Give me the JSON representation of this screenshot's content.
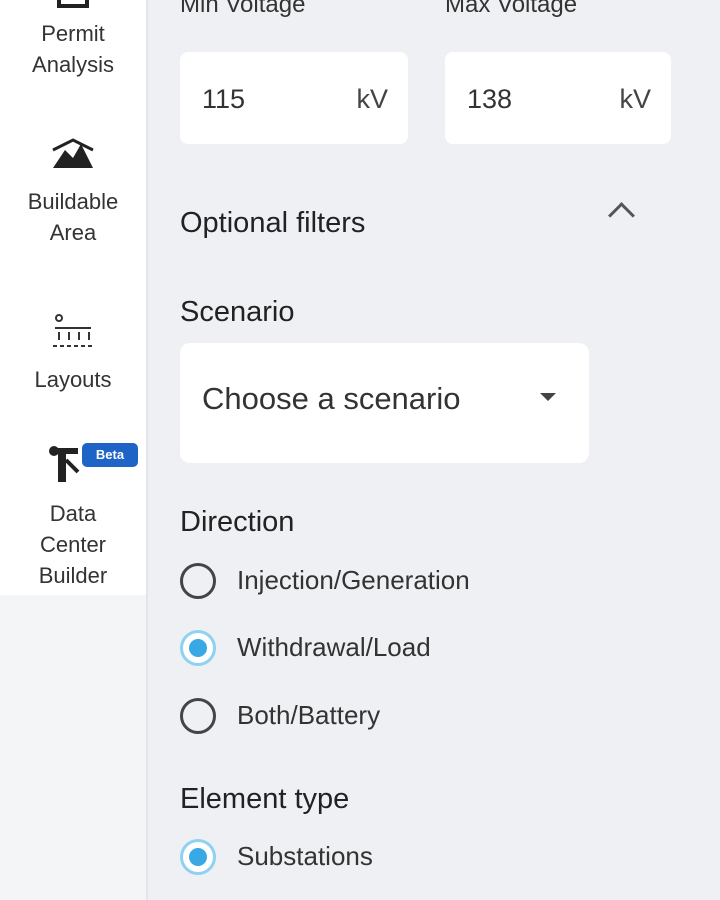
{
  "sidebar": {
    "items": [
      {
        "label": "Permit\nAnalysis",
        "icon": "document-icon"
      },
      {
        "label": "Buildable\nArea",
        "icon": "terrain-icon"
      },
      {
        "label": "Layouts",
        "icon": "layout-grid-icon"
      },
      {
        "label": "Data\nCenter\nBuilder",
        "icon": "crane-icon",
        "badge": "Beta"
      }
    ]
  },
  "voltage": {
    "min_label": "Min Voltage",
    "max_label": "Max Voltage",
    "min_value": "115",
    "max_value": "138",
    "unit": "kV"
  },
  "optional_filters": {
    "title": "Optional filters",
    "scenario": {
      "label": "Scenario",
      "placeholder": "Choose a scenario"
    },
    "direction": {
      "label": "Direction",
      "options": [
        {
          "label": "Injection/Generation",
          "checked": false
        },
        {
          "label": "Withdrawal/Load",
          "checked": true
        },
        {
          "label": "Both/Battery",
          "checked": false
        }
      ]
    },
    "element_type": {
      "label": "Element type",
      "options": [
        {
          "label": "Substations",
          "checked": true
        }
      ]
    }
  },
  "colors": {
    "accent": "#39a9e6",
    "badge": "#1e63c6",
    "background": "#eef0f4"
  }
}
